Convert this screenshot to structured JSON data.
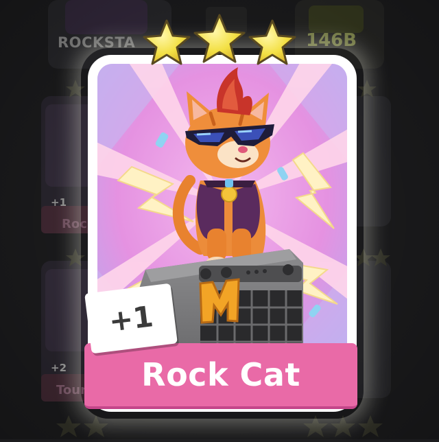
{
  "background": {
    "left_card_title": "ROCKSTA",
    "right_card_title": "146B",
    "left_card_plus_top": "+1",
    "left_card_label_top": "Rock",
    "left_card_plus_bottom": "+2",
    "left_card_label_bottom": "Tour"
  },
  "card": {
    "name": "Rock Cat",
    "count_badge": "+1",
    "star_rating": 3,
    "max_stars": 3,
    "emblem_letter": "M",
    "colors": {
      "banner": "#e96aa7",
      "star": "#f3e045",
      "card_border": "#ffffff",
      "art_background": "#e58fe0"
    }
  },
  "icons": [
    "star-icon",
    "m-logo-icon",
    "sunglasses-icon",
    "amplifier-icon",
    "cat-character-icon"
  ]
}
